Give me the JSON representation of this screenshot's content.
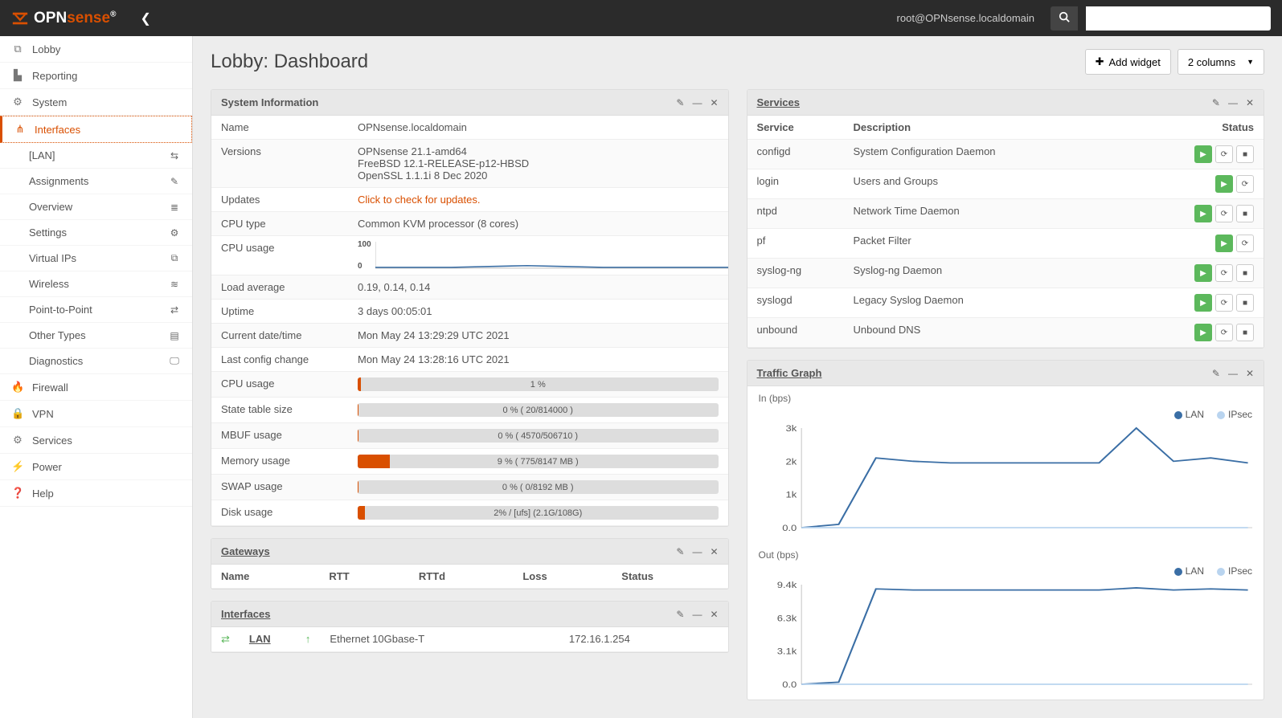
{
  "brand": {
    "opn": "OPN",
    "sense": "sense",
    "reg": "®"
  },
  "header": {
    "user": "root@OPNsense.localdomain",
    "search_placeholder": ""
  },
  "page": {
    "title": "Lobby: Dashboard",
    "add_widget": "Add widget",
    "columns": "2 columns"
  },
  "sidebar": {
    "top": [
      {
        "icon": "⧉",
        "label": "Lobby"
      },
      {
        "icon": "▙",
        "label": "Reporting"
      },
      {
        "icon": "⚙",
        "label": "System"
      },
      {
        "icon": "⋔",
        "label": "Interfaces",
        "active": true
      }
    ],
    "sub": [
      {
        "label": "[LAN]",
        "icon": "⇆"
      },
      {
        "label": "Assignments",
        "icon": "✎"
      },
      {
        "label": "Overview",
        "icon": "≣"
      },
      {
        "label": "Settings",
        "icon": "⚙"
      },
      {
        "label": "Virtual IPs",
        "icon": "⧉"
      },
      {
        "label": "Wireless",
        "icon": "≋"
      },
      {
        "label": "Point-to-Point",
        "icon": "⇄"
      },
      {
        "label": "Other Types",
        "icon": "▤"
      },
      {
        "label": "Diagnostics",
        "icon": "🖵"
      }
    ],
    "bottom": [
      {
        "icon": "🔥",
        "label": "Firewall"
      },
      {
        "icon": "🔒",
        "label": "VPN"
      },
      {
        "icon": "⚙",
        "label": "Services"
      },
      {
        "icon": "⚡",
        "label": "Power"
      },
      {
        "icon": "❓",
        "label": "Help"
      }
    ]
  },
  "sysinfo": {
    "title": "System Information",
    "rows": [
      {
        "k": "Name",
        "v": "OPNsense.localdomain"
      },
      {
        "k": "Versions",
        "v": "OPNsense 21.1-amd64\nFreeBSD 12.1-RELEASE-p12-HBSD\nOpenSSL 1.1.1i 8 Dec 2020"
      },
      {
        "k": "Updates",
        "v": "Click to check for updates.",
        "link": true
      },
      {
        "k": "CPU type",
        "v": "Common KVM processor (8 cores)"
      },
      {
        "k": "CPU usage",
        "spark": true,
        "ymin": "0",
        "ymax": "100"
      },
      {
        "k": "Load average",
        "v": "0.19, 0.14, 0.14"
      },
      {
        "k": "Uptime",
        "v": "3 days 00:05:01"
      },
      {
        "k": "Current date/time",
        "v": "Mon May 24 13:29:29 UTC 2021"
      },
      {
        "k": "Last config change",
        "v": "Mon May 24 13:28:16 UTC 2021"
      },
      {
        "k": "CPU usage",
        "bar": 1,
        "text": "1 %"
      },
      {
        "k": "State table size",
        "bar": 0.3,
        "text": "0 % ( 20/814000 )"
      },
      {
        "k": "MBUF usage",
        "bar": 0.3,
        "text": "0 % ( 4570/506710 )"
      },
      {
        "k": "Memory usage",
        "bar": 9,
        "text": "9 % ( 775/8147 MB )"
      },
      {
        "k": "SWAP usage",
        "bar": 0.3,
        "text": "0 % ( 0/8192 MB )"
      },
      {
        "k": "Disk usage",
        "bar": 2,
        "text": "2% / [ufs] (2.1G/108G)"
      }
    ]
  },
  "gateways": {
    "title": "Gateways",
    "headers": [
      "Name",
      "RTT",
      "RTTd",
      "Loss",
      "Status"
    ]
  },
  "ifaces": {
    "title": "Interfaces",
    "rows": [
      {
        "name": "LAN",
        "desc": "Ethernet 10Gbase-T <full-duplex>",
        "ip": "172.16.1.254"
      }
    ]
  },
  "services": {
    "title": "Services",
    "headers": [
      "Service",
      "Description",
      "Status"
    ],
    "rows": [
      {
        "svc": "configd",
        "desc": "System Configuration Daemon",
        "stop": true
      },
      {
        "svc": "login",
        "desc": "Users and Groups",
        "stop": false
      },
      {
        "svc": "ntpd",
        "desc": "Network Time Daemon",
        "stop": true
      },
      {
        "svc": "pf",
        "desc": "Packet Filter",
        "stop": false
      },
      {
        "svc": "syslog-ng",
        "desc": "Syslog-ng Daemon",
        "stop": true
      },
      {
        "svc": "syslogd",
        "desc": "Legacy Syslog Daemon",
        "stop": true
      },
      {
        "svc": "unbound",
        "desc": "Unbound DNS",
        "stop": true
      }
    ]
  },
  "traffic": {
    "title": "Traffic Graph",
    "in_label": "In (bps)",
    "out_label": "Out (bps)",
    "legend": [
      "LAN",
      "IPsec"
    ]
  },
  "chart_data": [
    {
      "type": "line",
      "title": "CPU usage",
      "ylim": [
        0,
        100
      ],
      "x": [
        0,
        1,
        2,
        3,
        4,
        5,
        6,
        7,
        8,
        9
      ],
      "series": [
        {
          "name": "cpu",
          "values": [
            2,
            2,
            2,
            3,
            5,
            3,
            2,
            2,
            2,
            2
          ]
        }
      ]
    },
    {
      "type": "line",
      "title": "In (bps)",
      "ylim": [
        0,
        3000
      ],
      "legend_position": "top-right",
      "x": [
        0,
        1,
        2,
        3,
        4,
        5,
        6,
        7,
        8,
        9,
        10,
        11,
        12
      ],
      "series": [
        {
          "name": "LAN",
          "values": [
            0,
            100,
            2100,
            2000,
            1950,
            1950,
            1950,
            1950,
            1950,
            3000,
            2000,
            2100,
            1950
          ]
        },
        {
          "name": "IPsec",
          "values": [
            0,
            0,
            0,
            0,
            0,
            0,
            0,
            0,
            0,
            0,
            0,
            0,
            0
          ]
        }
      ]
    },
    {
      "type": "line",
      "title": "Out (bps)",
      "ylim": [
        0,
        9400
      ],
      "legend_position": "top-right",
      "x": [
        0,
        1,
        2,
        3,
        4,
        5,
        6,
        7,
        8,
        9,
        10,
        11,
        12
      ],
      "series": [
        {
          "name": "LAN",
          "values": [
            0,
            200,
            9000,
            8900,
            8900,
            8900,
            8900,
            8900,
            8900,
            9100,
            8900,
            9000,
            8900
          ]
        },
        {
          "name": "IPsec",
          "values": [
            0,
            0,
            0,
            0,
            0,
            0,
            0,
            0,
            0,
            0,
            0,
            0,
            0
          ]
        }
      ]
    }
  ],
  "colors": {
    "lan": "#3a6ea5",
    "ipsec": "#b9d4ef",
    "accent": "#d94f00"
  }
}
